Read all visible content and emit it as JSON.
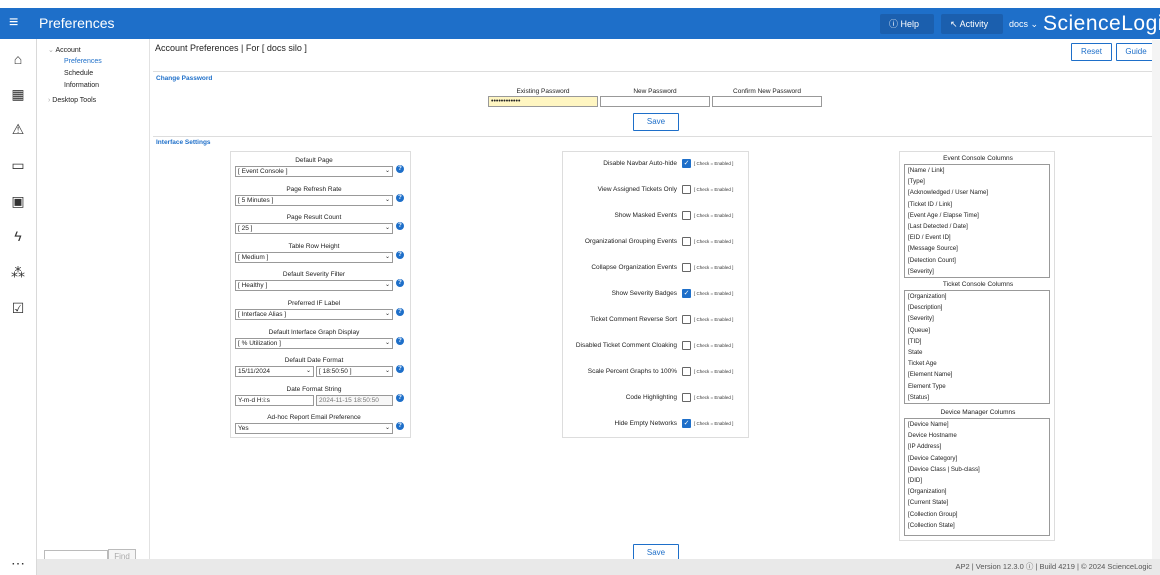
{
  "topbar": {
    "title": "Preferences",
    "help": "Help",
    "activity": "Activity",
    "user": "docs",
    "logo": "ScienceLogic"
  },
  "rail_icons": [
    "home-icon",
    "dashboard-icon",
    "alert-icon",
    "device-icon",
    "ticket-icon",
    "event-icon",
    "topology-icon",
    "checklist-icon",
    "more-icon"
  ],
  "nav": {
    "account": "Account",
    "preferences": "Preferences",
    "schedule": "Schedule",
    "information": "Information",
    "desktop_tools": "Desktop Tools",
    "find": "Find",
    "active_color": "#1e6fc9"
  },
  "page": {
    "title": "Account Preferences | For [ docs silo ]",
    "reset": "Reset",
    "guide": "Guide"
  },
  "password": {
    "section": "Change Password",
    "existing_label": "Existing Password",
    "new_label": "New Password",
    "confirm_label": "Confirm New Password",
    "existing_value": "••••••••••••",
    "save": "Save"
  },
  "interface": {
    "section": "Interface Settings",
    "left": [
      {
        "label": "Default Page",
        "value": "[ Event Console ]"
      },
      {
        "label": "Page Refresh Rate",
        "value": "[ 5 Minutes ]"
      },
      {
        "label": "Page Result Count",
        "value": "[ 25 ]"
      },
      {
        "label": "Table Row Height",
        "value": "[ Medium ]"
      },
      {
        "label": "Default Severity Filter",
        "value": "[ Healthy ]"
      },
      {
        "label": "Preferred IF Label",
        "value": "[ Interface Alias ]"
      },
      {
        "label": "Default Interface Graph Display",
        "value": "[ % Utilization ]"
      }
    ],
    "date_format": {
      "label": "Default Date Format",
      "date": "15/11/2024",
      "time": "[ 18:50:50 ]"
    },
    "date_string": {
      "label": "Date Format String",
      "value": "Y-m-d H:i:s",
      "preview": "2024-11-15 18:50:50"
    },
    "adhoc": {
      "label": "Ad-hoc Report Email Preference",
      "value": "Yes"
    },
    "check_note": "[ Check = Enabled ]",
    "toggles": [
      {
        "label": "Disable Navbar Auto-hide",
        "checked": true
      },
      {
        "label": "View Assigned Tickets Only",
        "checked": false
      },
      {
        "label": "Show Masked Events",
        "checked": false
      },
      {
        "label": "Organizational Grouping Events",
        "checked": false
      },
      {
        "label": "Collapse Organization Events",
        "checked": false
      },
      {
        "label": "Show Severity Badges",
        "checked": true
      },
      {
        "label": "Ticket Comment Reverse Sort",
        "checked": false
      },
      {
        "label": "Disabled Ticket Comment Cloaking",
        "checked": false
      },
      {
        "label": "Scale Percent Graphs to 100%",
        "checked": false
      },
      {
        "label": "Code Highlighting",
        "checked": false
      },
      {
        "label": "Hide Empty Networks",
        "checked": true
      }
    ],
    "event_columns": {
      "title": "Event Console Columns",
      "items": [
        "[Name / Link]",
        "[Type]",
        "[Acknowledged / User Name]",
        "[Ticket ID / Link]",
        "[Event Age / Elapse Time]",
        "[Last Detected / Date]",
        "[EID / Event ID]",
        "[Message Source]",
        "[Detection Count]",
        "[Severity]"
      ]
    },
    "ticket_columns": {
      "title": "Ticket Console Columns",
      "items": [
        "[Organization]",
        "[Description]",
        "[Severity]",
        "[Queue]",
        "[TID]",
        "State",
        "Ticket Age",
        "[Element Name]",
        "Element Type",
        "[Status]"
      ]
    },
    "device_columns": {
      "title": "Device Manager Columns",
      "items": [
        "[Device Name]",
        "Device Hostname",
        "[IP Address]",
        "[Device Category]",
        "[Device Class | Sub-class]",
        "[DID]",
        "[Organization]",
        "[Current State]",
        "[Collection Group]",
        "[Collection State]"
      ]
    },
    "save": "Save"
  },
  "footer": "AP2 | Version 12.3.0 ⓘ | Build 4219 | © 2024 ScienceLogic",
  "colors": {
    "brand": "#1e6fc9",
    "checked": "#1e6fc9",
    "password_fill": "#fff6c2"
  }
}
